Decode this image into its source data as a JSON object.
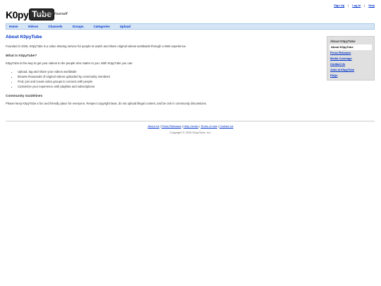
{
  "header": {
    "logo_k": "K0py",
    "logo_tube": "Tube",
    "tagline": "Broadcast Yourself",
    "top_links": [
      "Sign Up",
      "Log In",
      "Help"
    ]
  },
  "nav": {
    "items": [
      "Home",
      "Videos",
      "Channels",
      "Groups",
      "Categories",
      "Upload"
    ]
  },
  "main": {
    "title": "About K0pyTube",
    "intro": "Founded in 2026, K0pyTube is a video sharing service for people to watch and share original videos worldwide through a Web experience.",
    "what_title": "What is K0pyTube?",
    "what_text": "K0pyTube is the way to get your videos to the people who matter to you. With K0pyTube you can:",
    "features": [
      "Upload, tag and share your videos worldwide",
      "Browse thousands of original videos uploaded by community members",
      "Find, join and create video groups to connect with people",
      "Customize your experience with playlists and subscriptions"
    ],
    "guidelines_title": "Community Guidelines",
    "guidelines_text": "Please keep K0pyTube a fun and friendly place for everyone. Respect copyright laws, do not upload illegal content, and be civil in community discussions."
  },
  "sidebar": {
    "heading": "About K0pyTube",
    "items": [
      "About K0pyTube",
      "Press Releases",
      "Media Coverage",
      "Contact Us",
      "Jobs at K0pyTube",
      "FAQs"
    ]
  },
  "footer": {
    "links": [
      "About Us",
      "Press Releases",
      "Help Center",
      "Terms of Use",
      "Contact Us"
    ],
    "copyright": "Copyright © 2026 K0pyTube, Inc."
  },
  "colors": {
    "link": "#0033cc",
    "nav_bg": "#d5e5f5",
    "sidebar_bg": "#e0e0e0"
  }
}
